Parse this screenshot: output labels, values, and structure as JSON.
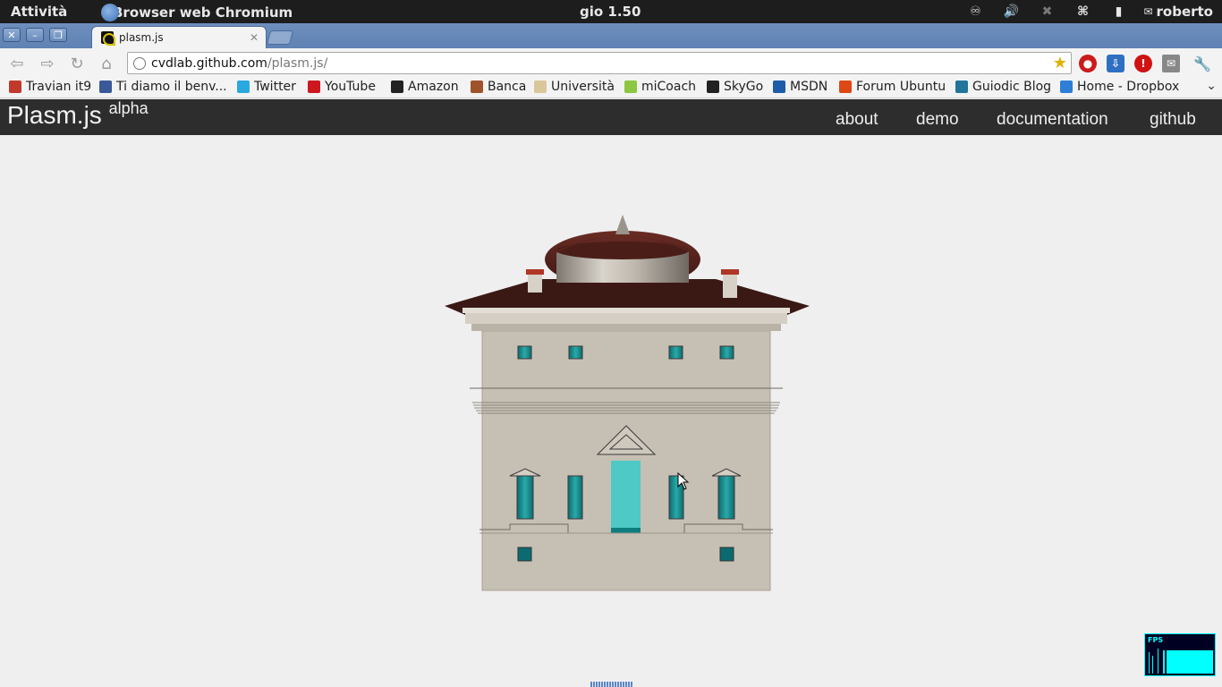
{
  "top_panel": {
    "activities": "Attività",
    "app_name": "Browser web Chromium",
    "clock": "gio  1.50",
    "user": "roberto"
  },
  "browser": {
    "tab_title": "plasm.js",
    "url_host": "cvdlab.github.com",
    "url_path": "/plasm.js/",
    "bookmarks": [
      {
        "label": "Travian it9",
        "icon": "travian-icon",
        "color": "#c0392b"
      },
      {
        "label": "Ti diamo il benv...",
        "icon": "facebook-icon",
        "color": "#3b5998"
      },
      {
        "label": "Twitter",
        "icon": "twitter-icon",
        "color": "#2aa9e0"
      },
      {
        "label": "YouTube",
        "icon": "youtube-icon",
        "color": "#cc181e"
      },
      {
        "label": "Amazon",
        "icon": "amazon-icon",
        "color": "#222222"
      },
      {
        "label": "Banca",
        "icon": "banca-icon",
        "color": "#a0522d"
      },
      {
        "label": "Università",
        "icon": "folder-icon",
        "color": "#d9c79a"
      },
      {
        "label": "miCoach",
        "icon": "micoach-icon",
        "color": "#8dc63f"
      },
      {
        "label": "SkyGo",
        "icon": "sky-icon",
        "color": "#222222"
      },
      {
        "label": "MSDN",
        "icon": "msdn-icon",
        "color": "#1f5ca8"
      },
      {
        "label": "Forum Ubuntu",
        "icon": "ubuntu-icon",
        "color": "#dd4814"
      },
      {
        "label": "Guiodic Blog",
        "icon": "wordpress-icon",
        "color": "#21759b"
      },
      {
        "label": "Home - Dropbox",
        "icon": "dropbox-icon",
        "color": "#2e7ed6"
      }
    ]
  },
  "site": {
    "brand": "Plasm.js",
    "brand_tag": "alpha",
    "nav": [
      "about",
      "demo",
      "documentation",
      "github"
    ]
  },
  "fps_widget": {
    "label": "FPS"
  }
}
